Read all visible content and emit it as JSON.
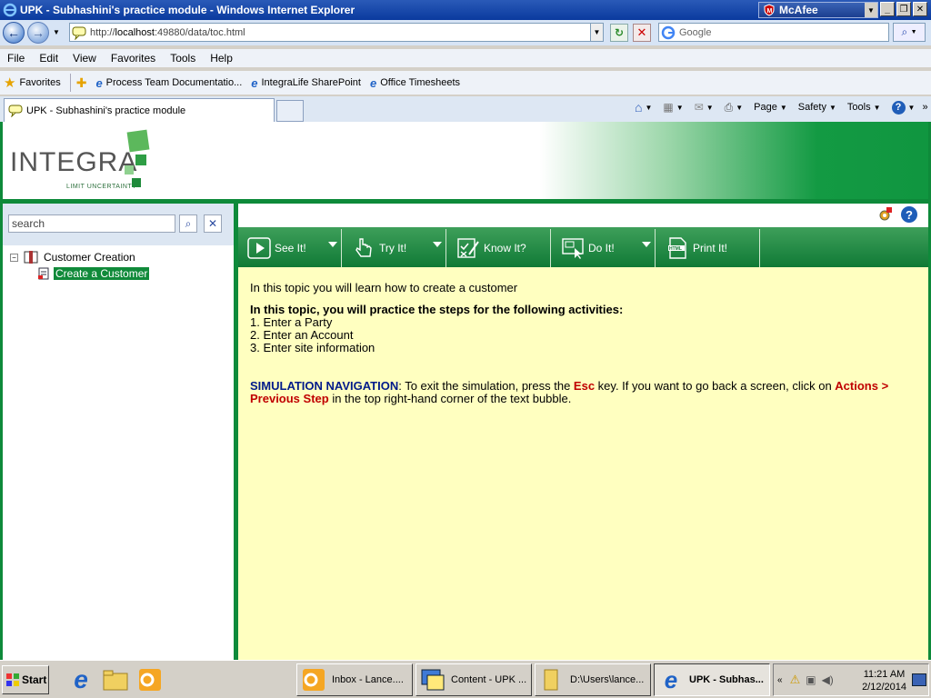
{
  "window": {
    "title": "UPK - Subhashini's practice module - Windows Internet Explorer",
    "mcafee_label": "McAfee"
  },
  "address": {
    "url_prefix": "http://",
    "url_host": "localhost",
    "url_rest": ":49880/data/toc.html",
    "search_placeholder": "Google"
  },
  "menu": [
    "File",
    "Edit",
    "View",
    "Favorites",
    "Tools",
    "Help"
  ],
  "favorites": {
    "label": "Favorites",
    "links": [
      "Process Team Documentatio...",
      "IntegraLife SharePoint",
      "Office Timesheets"
    ]
  },
  "tab": {
    "label": "UPK - Subhashini's practice module"
  },
  "commands": [
    "Page",
    "Safety",
    "Tools"
  ],
  "brand": {
    "name": "INTEGRA",
    "tagline": "LIMIT UNCERTAINTY"
  },
  "left": {
    "search_value": "search",
    "tree": {
      "root": "Customer Creation",
      "child": "Create a Customer"
    }
  },
  "modes": [
    "See It!",
    "Try It!",
    "Know It?",
    "Do It!",
    "Print It!"
  ],
  "body": {
    "intro": "In this topic you will learn how to create a customer",
    "heading": "In this topic, you will practice the steps for the following activities:",
    "steps": [
      "1. Enter a Party",
      "2. Enter an Account",
      "3. Enter site information"
    ],
    "nav_label": "SIMULATION NAVIGATION",
    "nav_text_1": ": To exit the simulation, press the ",
    "esc": "Esc",
    "nav_text_2": " key. If you want to go back a screen, click on ",
    "actions": "Actions > Previous Step",
    "nav_text_3": " in the top right-hand corner of the text bubble."
  },
  "taskbar": {
    "start": "Start",
    "tasks": [
      "Inbox - Lance....",
      "Content - UPK ...",
      "D:\\Users\\lance...",
      "UPK - Subhas..."
    ],
    "time": "11:21 AM",
    "date": "2/12/2014"
  },
  "colors": {
    "brand_green": "#0e8a3a",
    "content_bg": "#ffffc0",
    "nav_blue": "#001a8a",
    "alert_red": "#c00000"
  }
}
